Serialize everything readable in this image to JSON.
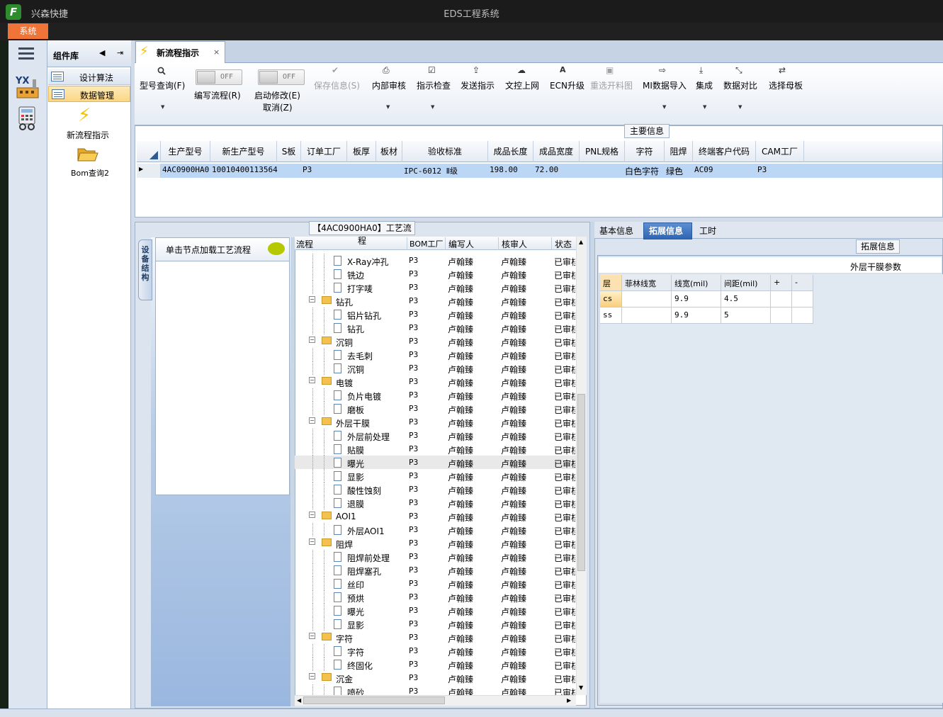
{
  "app": {
    "name": "兴森快捷",
    "window_title": "EDS工程系统",
    "logo_letter": "F",
    "system_menu": "系统"
  },
  "component_library": {
    "title": "组件库",
    "items": [
      {
        "label": "设计算法"
      },
      {
        "label": "数据管理",
        "selected": true
      }
    ],
    "tools": [
      {
        "label": "新流程指示"
      },
      {
        "label": "Bom查询2"
      }
    ]
  },
  "doc_tab": {
    "label": "新流程指示",
    "close": "×"
  },
  "toolbar": {
    "items": [
      {
        "label": "型号查询(F)",
        "icon": "search-icon",
        "enabled": true,
        "dropdown": true
      },
      {
        "label": "编写流程(R)",
        "toggle": "OFF",
        "enabled": true
      },
      {
        "label": "启动修改(E)",
        "sub_label": "取消(Z)",
        "toggle": "OFF",
        "enabled": true
      },
      {
        "label": "保存信息(S)",
        "icon": "check-icon",
        "enabled": false
      },
      {
        "label": "内部审核",
        "icon": "print-icon",
        "enabled": true,
        "dropdown": true
      },
      {
        "label": "指示检查",
        "icon": "checkbox-icon",
        "enabled": true,
        "dropdown": true
      },
      {
        "label": "发送指示",
        "icon": "upload-icon",
        "enabled": true
      },
      {
        "label": "文控上网",
        "icon": "cloud-upload-icon",
        "enabled": true
      },
      {
        "label": "ECN升级",
        "icon": "font-icon",
        "enabled": true
      },
      {
        "label": "重选开料图",
        "icon": "image-icon",
        "enabled": false
      },
      {
        "label": "MI数据导入",
        "icon": "import-icon",
        "enabled": true,
        "dropdown": true
      },
      {
        "label": "集成",
        "icon": "download-icon",
        "enabled": true,
        "dropdown": true
      },
      {
        "label": "数据对比",
        "icon": "compress-icon",
        "enabled": true,
        "dropdown": true
      },
      {
        "label": "选择母板",
        "icon": "shuffle-icon",
        "enabled": true
      }
    ]
  },
  "main_info": {
    "caption": "主要信息",
    "columns": [
      "生产型号",
      "新生产型号",
      "S板",
      "订单工厂",
      "板厚",
      "板材",
      "验收标准",
      "成品长度",
      "成品宽度",
      "PNL规格",
      "字符",
      "阻焊",
      "终端客户代码",
      "CAM工厂"
    ],
    "row": [
      "4AC0900HA0",
      "10010400113564",
      "",
      "P3",
      "",
      "",
      "IPC-6012 Ⅱ级",
      "198.00",
      "72.00",
      "",
      "白色字符",
      "绿色",
      "AC09",
      "P3"
    ]
  },
  "process": {
    "caption": "【4AC0900HA0】工艺流程",
    "side_tab": "设备结构",
    "click_hint": "单击节点加载工艺流程",
    "columns": [
      "流程",
      "BOM工厂",
      "编写人",
      "核审人",
      "状态"
    ],
    "rows": [
      {
        "name": "X-Ray冲孔",
        "level": 1,
        "bom": "P3",
        "writer": "卢翰臻",
        "reviewer": "卢翰臻",
        "status": "已审核"
      },
      {
        "name": "铣边",
        "level": 1,
        "bom": "P3",
        "writer": "卢翰臻",
        "reviewer": "卢翰臻",
        "status": "已审核"
      },
      {
        "name": "打字唛",
        "level": 1,
        "bom": "P3",
        "writer": "卢翰臻",
        "reviewer": "卢翰臻",
        "status": "已审核"
      },
      {
        "name": "钻孔",
        "level": 0,
        "bom": "P3",
        "writer": "卢翰臻",
        "reviewer": "卢翰臻",
        "status": "已审核"
      },
      {
        "name": "铝片钻孔",
        "level": 1,
        "bom": "P3",
        "writer": "卢翰臻",
        "reviewer": "卢翰臻",
        "status": "已审核"
      },
      {
        "name": "钻孔",
        "level": 1,
        "bom": "P3",
        "writer": "卢翰臻",
        "reviewer": "卢翰臻",
        "status": "已审核"
      },
      {
        "name": "沉铜",
        "level": 0,
        "bom": "P3",
        "writer": "卢翰臻",
        "reviewer": "卢翰臻",
        "status": "已审核"
      },
      {
        "name": "去毛刺",
        "level": 1,
        "bom": "P3",
        "writer": "卢翰臻",
        "reviewer": "卢翰臻",
        "status": "已审核"
      },
      {
        "name": "沉铜",
        "level": 1,
        "bom": "P3",
        "writer": "卢翰臻",
        "reviewer": "卢翰臻",
        "status": "已审核"
      },
      {
        "name": "电镀",
        "level": 0,
        "bom": "P3",
        "writer": "卢翰臻",
        "reviewer": "卢翰臻",
        "status": "已审核"
      },
      {
        "name": "负片电镀",
        "level": 1,
        "bom": "P3",
        "writer": "卢翰臻",
        "reviewer": "卢翰臻",
        "status": "已审核"
      },
      {
        "name": "磨板",
        "level": 1,
        "bom": "P3",
        "writer": "卢翰臻",
        "reviewer": "卢翰臻",
        "status": "已审核"
      },
      {
        "name": "外层干膜",
        "level": 0,
        "bom": "P3",
        "writer": "卢翰臻",
        "reviewer": "卢翰臻",
        "status": "已审核"
      },
      {
        "name": "外层前处理",
        "level": 1,
        "bom": "P3",
        "writer": "卢翰臻",
        "reviewer": "卢翰臻",
        "status": "已审核"
      },
      {
        "name": "贴膜",
        "level": 1,
        "bom": "P3",
        "writer": "卢翰臻",
        "reviewer": "卢翰臻",
        "status": "已审核"
      },
      {
        "name": "曝光",
        "level": 1,
        "bom": "P3",
        "writer": "卢翰臻",
        "reviewer": "卢翰臻",
        "status": "已审核",
        "highlighted": true
      },
      {
        "name": "显影",
        "level": 1,
        "bom": "P3",
        "writer": "卢翰臻",
        "reviewer": "卢翰臻",
        "status": "已审核"
      },
      {
        "name": "酸性蚀刻",
        "level": 1,
        "bom": "P3",
        "writer": "卢翰臻",
        "reviewer": "卢翰臻",
        "status": "已审核"
      },
      {
        "name": "退膜",
        "level": 1,
        "bom": "P3",
        "writer": "卢翰臻",
        "reviewer": "卢翰臻",
        "status": "已审核"
      },
      {
        "name": "AOI1",
        "level": 0,
        "bom": "P3",
        "writer": "卢翰臻",
        "reviewer": "卢翰臻",
        "status": "已审核"
      },
      {
        "name": "外层AOI1",
        "level": 1,
        "bom": "P3",
        "writer": "卢翰臻",
        "reviewer": "卢翰臻",
        "status": "已审核"
      },
      {
        "name": "阻焊",
        "level": 0,
        "bom": "P3",
        "writer": "卢翰臻",
        "reviewer": "卢翰臻",
        "status": "已审核"
      },
      {
        "name": "阻焊前处理",
        "level": 1,
        "bom": "P3",
        "writer": "卢翰臻",
        "reviewer": "卢翰臻",
        "status": "已审核"
      },
      {
        "name": "阻焊塞孔",
        "level": 1,
        "bom": "P3",
        "writer": "卢翰臻",
        "reviewer": "卢翰臻",
        "status": "已审核"
      },
      {
        "name": "丝印",
        "level": 1,
        "bom": "P3",
        "writer": "卢翰臻",
        "reviewer": "卢翰臻",
        "status": "已审核"
      },
      {
        "name": "预烘",
        "level": 1,
        "bom": "P3",
        "writer": "卢翰臻",
        "reviewer": "卢翰臻",
        "status": "已审核"
      },
      {
        "name": "曝光",
        "level": 1,
        "bom": "P3",
        "writer": "卢翰臻",
        "reviewer": "卢翰臻",
        "status": "已审核"
      },
      {
        "name": "显影",
        "level": 1,
        "bom": "P3",
        "writer": "卢翰臻",
        "reviewer": "卢翰臻",
        "status": "已审核"
      },
      {
        "name": "字符",
        "level": 0,
        "bom": "P3",
        "writer": "卢翰臻",
        "reviewer": "卢翰臻",
        "status": "已审核"
      },
      {
        "name": "字符",
        "level": 1,
        "bom": "P3",
        "writer": "卢翰臻",
        "reviewer": "卢翰臻",
        "status": "已审核"
      },
      {
        "name": "终固化",
        "level": 1,
        "bom": "P3",
        "writer": "卢翰臻",
        "reviewer": "卢翰臻",
        "status": "已审核"
      },
      {
        "name": "沉金",
        "level": 0,
        "bom": "P3",
        "writer": "卢翰臻",
        "reviewer": "卢翰臻",
        "status": "已审核"
      },
      {
        "name": "喷砂",
        "level": 1,
        "bom": "P3",
        "writer": "卢翰臻",
        "reviewer": "卢翰臻",
        "status": "已审核"
      }
    ]
  },
  "right": {
    "tabs": [
      {
        "label": "基本信息"
      },
      {
        "label": "拓展信息",
        "selected": true
      },
      {
        "label": "工时"
      }
    ],
    "ext_caption": "拓展信息",
    "table_title": "外层干膜参数",
    "columns": [
      "层",
      "菲林线宽",
      "线宽(mil)",
      "间距(mil)",
      "+",
      "-"
    ],
    "rows": [
      [
        "cs",
        "",
        "9.9",
        "4.5",
        "",
        ""
      ],
      [
        "ss",
        "",
        "9.9",
        "5",
        "",
        ""
      ]
    ]
  }
}
